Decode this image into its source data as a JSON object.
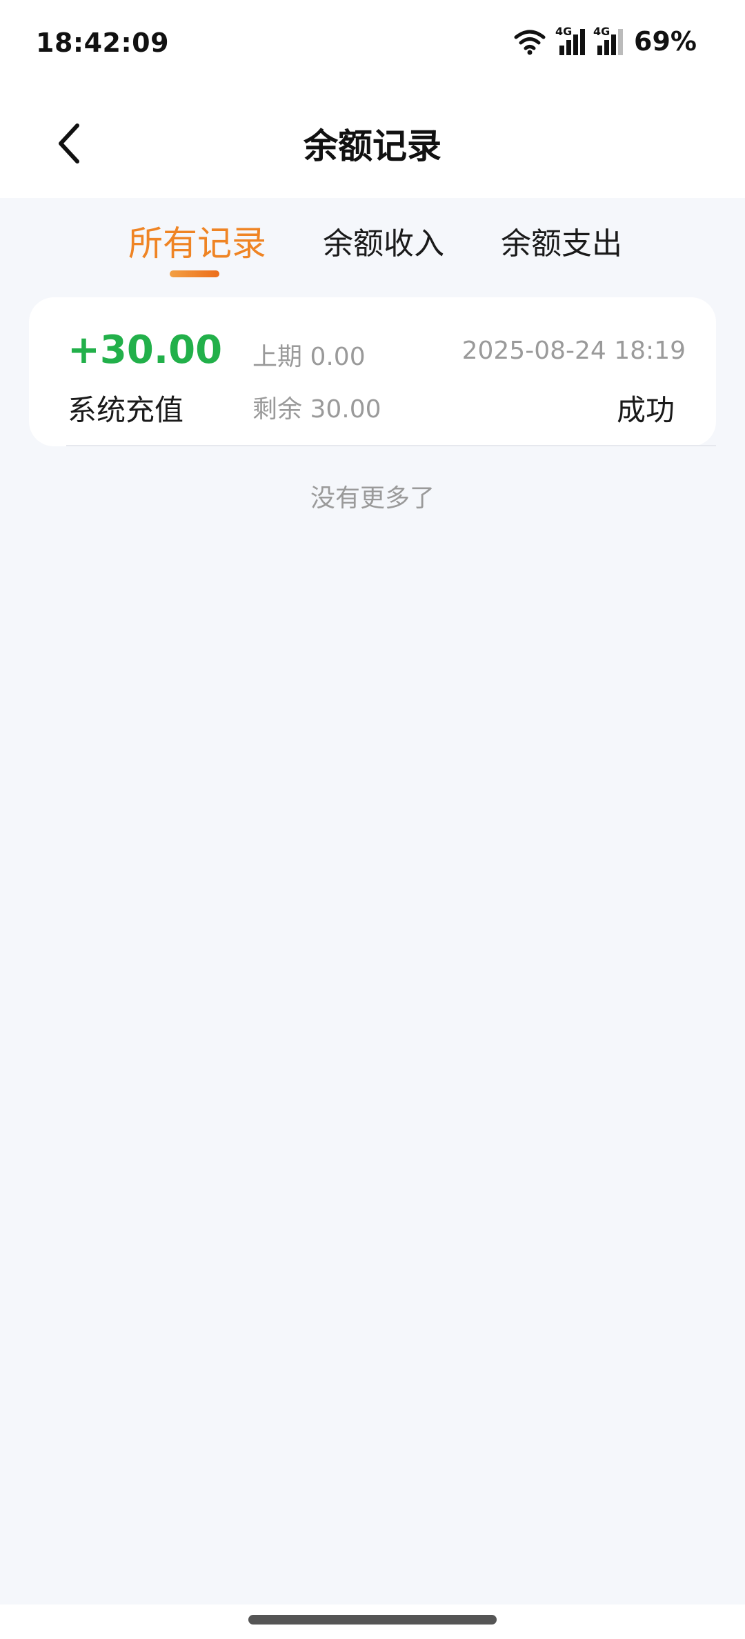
{
  "status_bar": {
    "time": "18:42:09",
    "wifi_icon": "wifi-icon",
    "signal_label_1": "4G",
    "signal_label_2": "4G",
    "battery": "69%"
  },
  "header": {
    "back_icon": "chevron-left-icon",
    "title": "余额记录"
  },
  "tabs": [
    {
      "label": "所有记录",
      "active": true
    },
    {
      "label": "余额收入",
      "active": false
    },
    {
      "label": "余额支出",
      "active": false
    }
  ],
  "records": [
    {
      "amount": "+30.00",
      "description": "系统充值",
      "previous": "上期 0.00",
      "remaining": "剩余 30.00",
      "datetime": "2025-08-24 18:19",
      "status": "成功"
    }
  ],
  "footer_text": "没有更多了",
  "colors": {
    "accent": "#ef8424",
    "amount_positive": "#22b04a",
    "muted_text": "#9a9a9a",
    "background": "#f5f7fb"
  }
}
